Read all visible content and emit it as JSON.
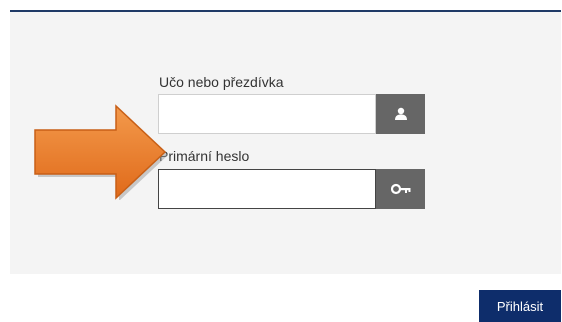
{
  "form": {
    "username_label": "Učo nebo přezdívka",
    "username_value": "",
    "username_icon": "user-icon",
    "password_label": "Primární heslo",
    "password_value": "",
    "password_icon": "key-icon",
    "submit_label": "Přihlásit"
  },
  "annotation": {
    "arrow_icon": "arrow-right-icon",
    "arrow_color": "#e87a2a"
  },
  "colors": {
    "header_line": "#1f3a66",
    "panel_bg": "#f4f4f4",
    "addon_bg": "#666666",
    "submit_bg": "#0e2d6b"
  }
}
